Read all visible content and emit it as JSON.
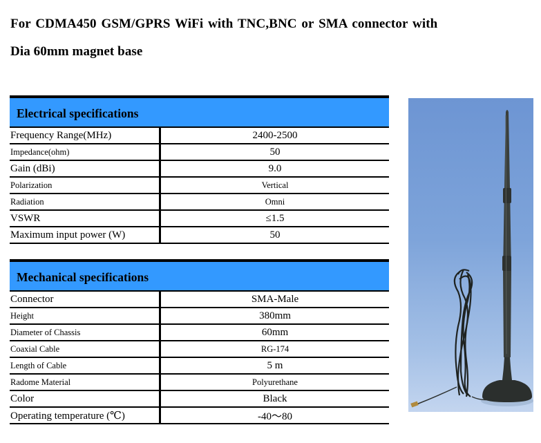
{
  "title": {
    "line1": "For CDMA450 GSM/GPRS WiFi with TNC,BNC or SMA connector with",
    "line2": "Dia 60mm magnet base"
  },
  "electrical": {
    "heading": "Electrical specifications",
    "rows": [
      {
        "label": "Frequency Range(MHz)",
        "value": "2400-2500"
      },
      {
        "label": "Impedance(ohm)",
        "value": "50"
      },
      {
        "label": "Gain (dBi)",
        "value": "9.0"
      },
      {
        "label": "Polarization",
        "value": "Vertical"
      },
      {
        "label": "Radiation",
        "value": "Omni"
      },
      {
        "label": "VSWR",
        "value": "≤1.5"
      },
      {
        "label": "Maximum input power (W)",
        "value": "50"
      }
    ]
  },
  "mechanical": {
    "heading": "Mechanical specifications",
    "rows": [
      {
        "label": "Connector",
        "value": "SMA-Male"
      },
      {
        "label": "Height",
        "value": "380mm"
      },
      {
        "label": "Diameter of Chassis",
        "value": "60mm"
      },
      {
        "label": "Coaxial Cable",
        "value": "RG-174"
      },
      {
        "label": "Length of Cable",
        "value": "5 m"
      },
      {
        "label": "Radome Material",
        "value": "Polyurethane"
      },
      {
        "label": "Color",
        "value": "Black"
      },
      {
        "label": "Operating temperature (℃)",
        "value": "-40～80"
      }
    ]
  },
  "product_image": {
    "subject": "black magnetic-base whip antenna with coiled coaxial cable",
    "background_color": "#7ea4da"
  }
}
